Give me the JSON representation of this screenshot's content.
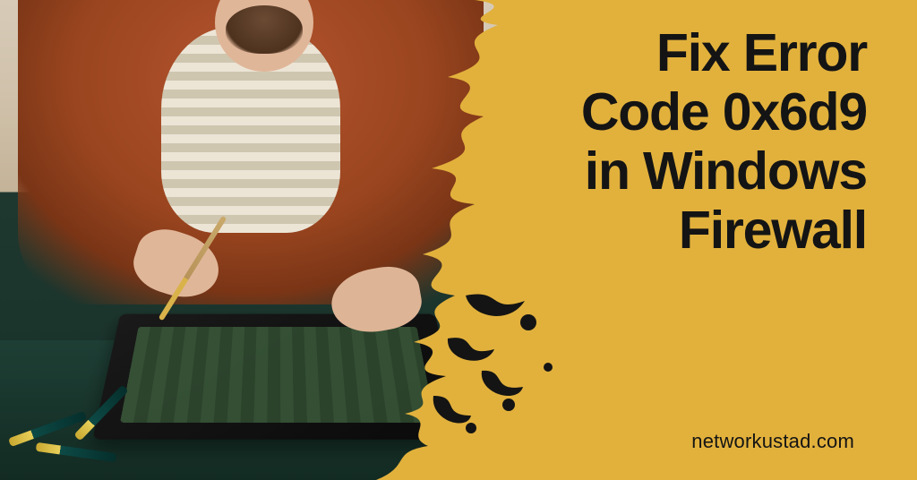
{
  "title_lines": [
    "Fix Error",
    "Code 0x6d9",
    "in Windows",
    "Firewall"
  ],
  "site": "networkustad.com",
  "colors": {
    "background": "#e2b13c",
    "text": "#141414",
    "splash": "#141414"
  },
  "image_description": "Man in rust-orange open shirt over striped tee repairing an opened laptop with a brush on a green workbench; screwdrivers on the table."
}
